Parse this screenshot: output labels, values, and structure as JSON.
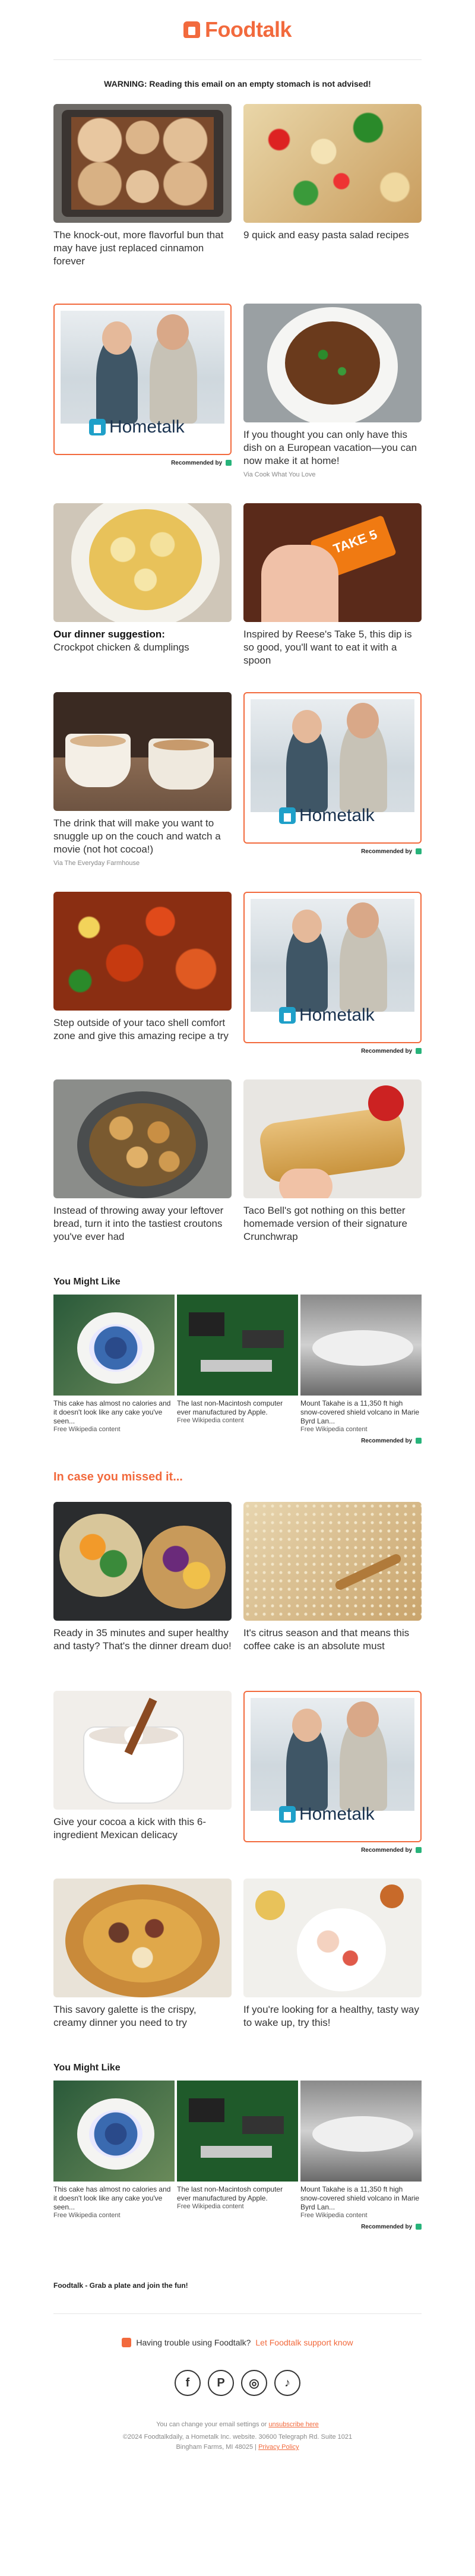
{
  "brand": {
    "name": "Foodtalk",
    "accent": "#f26a3d"
  },
  "warning": "WARNING: Reading this email on an empty stomach is not advised!",
  "rows": [
    {
      "left": {
        "caption": "The knock-out, more flavorful bun that may have just replaced cinnamon forever",
        "via": ""
      },
      "right": {
        "caption": "9 quick and easy pasta salad recipes",
        "via": ""
      }
    },
    {
      "left": {
        "ad": true,
        "logo": "Hometalk",
        "rec": "Recommended by"
      },
      "right": {
        "caption": "If you thought you can only have this dish on a European vacation—you can now make it at home!",
        "via": "Via Cook What You Love"
      }
    },
    {
      "left": {
        "bold": "Our dinner suggestion:",
        "caption": "Crockpot chicken & dumplings",
        "via": ""
      },
      "right": {
        "caption": "Inspired by Reese's Take 5, this dip is so good, you'll want to eat it with a spoon",
        "via": ""
      }
    },
    {
      "left": {
        "caption": "The drink that will make you want to snuggle up on the couch and watch a movie (not hot cocoa!)",
        "via": "Via The Everyday Farmhouse"
      },
      "right": {
        "ad": true,
        "logo": "Hometalk",
        "rec": "Recommended by"
      }
    },
    {
      "left": {
        "caption": "Step outside of your taco shell comfort zone and give this amazing recipe a try",
        "via": ""
      },
      "right": {
        "ad": true,
        "logo": "Hometalk",
        "rec": "Recommended by"
      }
    },
    {
      "left": {
        "caption": "Instead of throwing away your leftover bread, turn it into the tastiest croutons you've ever had",
        "via": ""
      },
      "right": {
        "caption": "Taco Bell's got nothing on this better homemade version of their signature Crunchwrap",
        "via": ""
      }
    }
  ],
  "you_might_like": {
    "title": "You Might Like",
    "items": [
      {
        "title": "This cake has almost no calories and it doesn't look like any cake you've seen...",
        "via": "Free Wikipedia content"
      },
      {
        "title": "The last non-Macintosh computer ever manufactured by Apple.",
        "via": "Free Wikipedia content"
      },
      {
        "title": "Mount Takahe is a 11,350 ft high snow-covered shield volcano in Marie Byrd Lan...",
        "via": "Free Wikipedia content"
      }
    ],
    "rec": "Recommended by"
  },
  "missed": {
    "title": "In case you missed it...",
    "rows": [
      {
        "left": {
          "caption": "Ready in 35 minutes and super healthy and tasty? That's the dinner dream duo!"
        },
        "right": {
          "caption": "It's citrus season and that means this coffee cake is an absolute must"
        }
      },
      {
        "left": {
          "caption": "Give your cocoa a kick with this 6-ingredient Mexican delicacy"
        },
        "right": {
          "ad": true,
          "logo": "Hometalk",
          "rec": "Recommended by"
        }
      },
      {
        "left": {
          "caption": "This savory galette is the crispy, creamy dinner you need to try"
        },
        "right": {
          "caption": "If you're looking for a healthy, tasty way to wake up, try this!"
        }
      }
    ]
  },
  "tagline": "Foodtalk - Grab a plate and join the fun!",
  "support": {
    "text": "Having trouble using Foodtalk?",
    "link": "Let Foodtalk support know"
  },
  "social": [
    "f",
    "P",
    "◎",
    "♪"
  ],
  "legal": {
    "settings_pre": "You can change your email settings or",
    "unsubscribe": "unsubscribe here",
    "address": "©2024 Foodtalkdaily, a Hometalk Inc. website. 30600 Telegraph Rd. Suite 1021",
    "address2": "Bingham Farms, MI 48025",
    "privacy": "Privacy Policy"
  }
}
